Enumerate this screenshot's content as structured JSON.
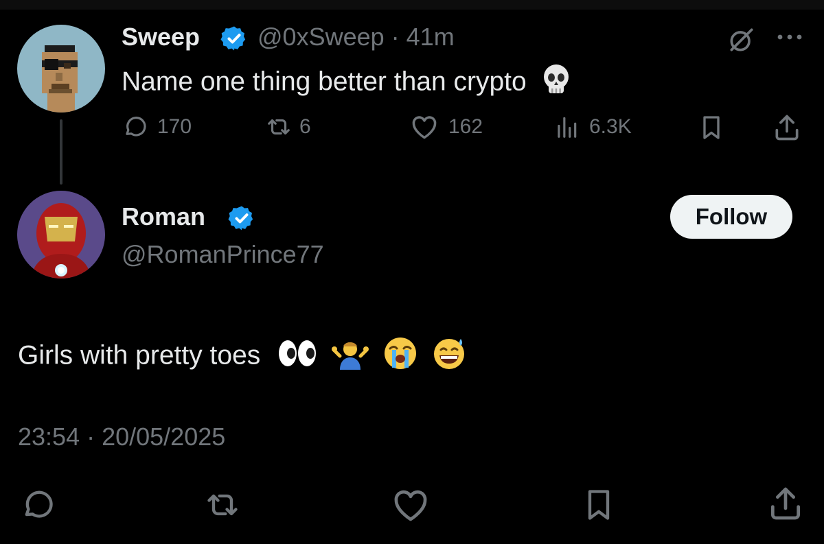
{
  "parent_post": {
    "display_name": "Sweep",
    "handle": "@0xSweep",
    "separator": "·",
    "time_ago": "41m",
    "text": "Name one thing better than crypto",
    "emoji": "skull",
    "metrics": {
      "replies": "170",
      "reposts": "6",
      "likes": "162",
      "views": "6.3K"
    }
  },
  "reply_post": {
    "display_name": "Roman",
    "handle": "@RomanPrince77",
    "follow_label": "Follow",
    "text": "Girls with pretty toes",
    "emojis": [
      "eyes",
      "person-shrugging",
      "loudly-crying-face",
      "grinning-face-with-sweat"
    ],
    "timestamp": "23:54 · 20/05/2025"
  },
  "colors": {
    "background": "#000000",
    "text_primary": "#e7e9ea",
    "text_muted": "#71767b",
    "verified_blue": "#1d9bf0",
    "follow_bg": "#eff3f4",
    "thread_line": "#333639"
  }
}
